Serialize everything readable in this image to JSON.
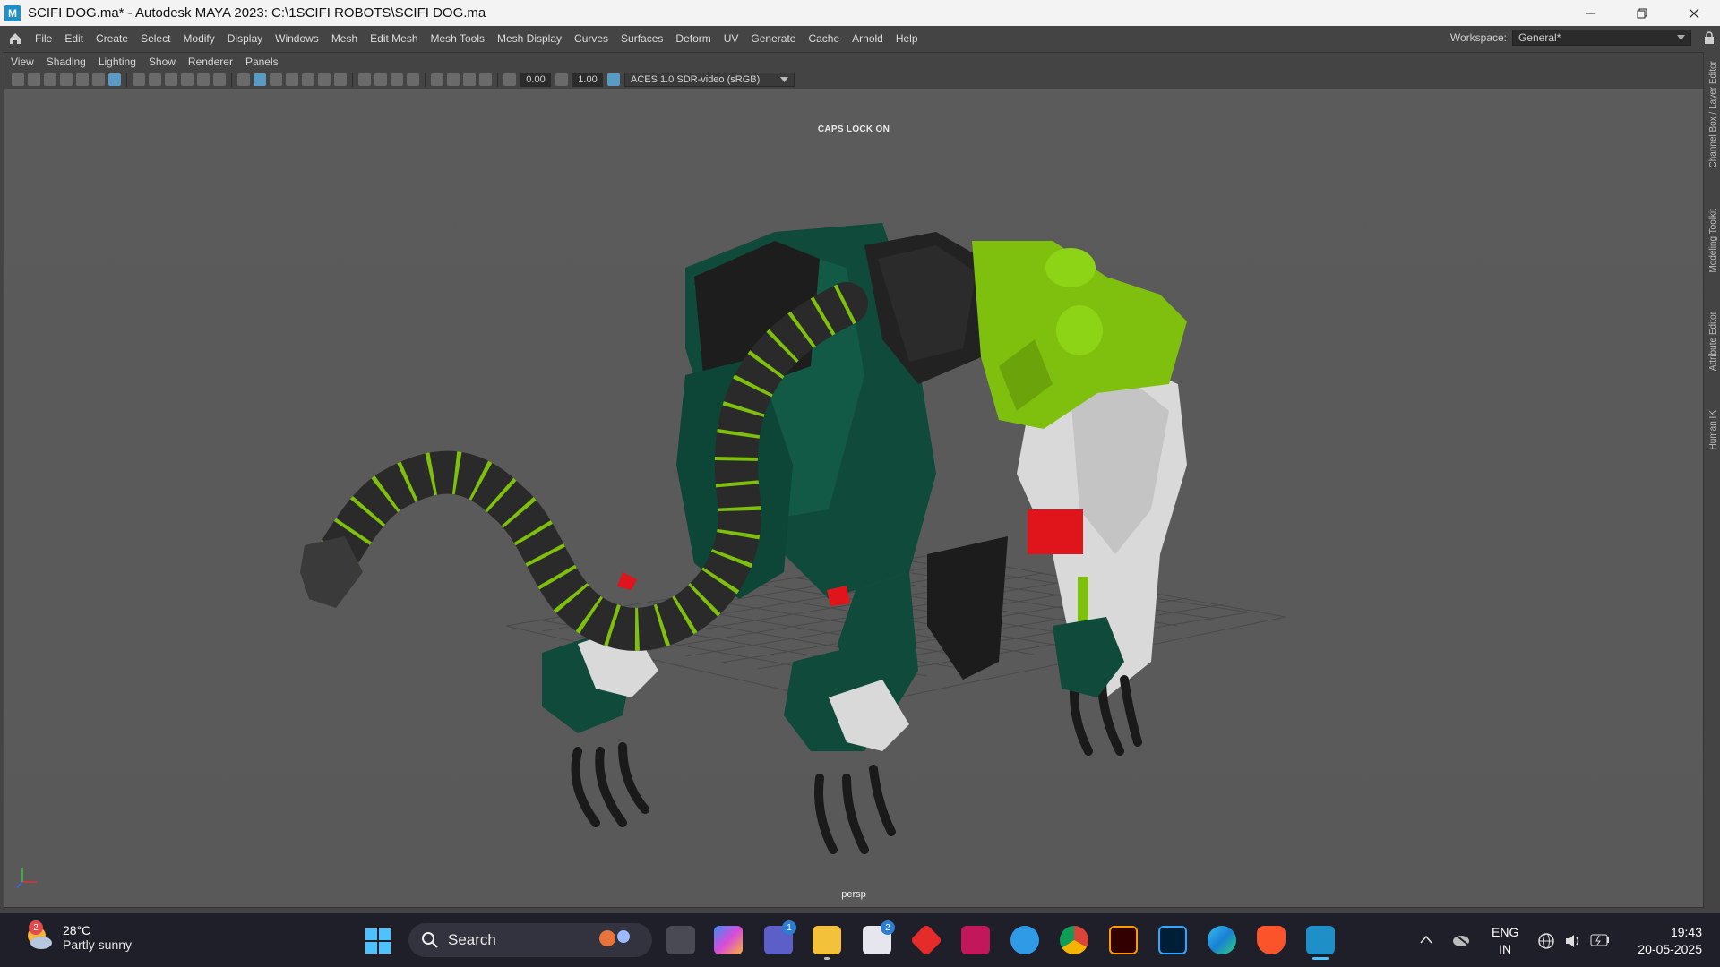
{
  "window": {
    "title": "SCIFI DOG.ma* - Autodesk MAYA 2023: C:\\1SCIFI ROBOTS\\SCIFI DOG.ma",
    "app_logo": "M"
  },
  "menubar": {
    "items": [
      "File",
      "Edit",
      "Create",
      "Select",
      "Modify",
      "Display",
      "Windows",
      "Mesh",
      "Edit Mesh",
      "Mesh Tools",
      "Mesh Display",
      "Curves",
      "Surfaces",
      "Deform",
      "UV",
      "Generate",
      "Cache",
      "Arnold",
      "Help"
    ],
    "workspace_label": "Workspace:",
    "workspace_value": "General*"
  },
  "panel": {
    "menu": [
      "View",
      "Shading",
      "Lighting",
      "Show",
      "Renderer",
      "Panels"
    ],
    "exposure": "0.00",
    "gamma": "1.00",
    "color_space": "ACES 1.0 SDR-video (sRGB)",
    "caps_lock": "CAPS LOCK ON",
    "camera": "persp"
  },
  "dock": {
    "tabs": [
      "Channel Box / Layer Editor",
      "Modeling Toolkit",
      "Attribute Editor",
      "Human IK"
    ]
  },
  "taskbar": {
    "weather_temp": "28°C",
    "weather_desc": "Partly sunny",
    "weather_badge": "2",
    "search_label": "Search",
    "teams_badge": "1",
    "store_badge": "2",
    "lang_top": "ENG",
    "lang_bottom": "IN",
    "time": "19:43",
    "date": "20-05-2025"
  },
  "colors": {
    "robot_dark_green": "#0f4a3a",
    "robot_lime": "#7ec00d",
    "robot_white": "#d9d9d9",
    "robot_red": "#e0141b",
    "tail_black": "#2a2a2a"
  }
}
